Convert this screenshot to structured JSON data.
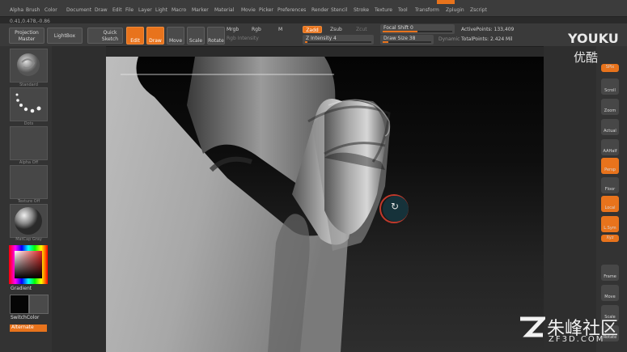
{
  "menu": [
    "Alpha",
    "Brush",
    "Color",
    "Document",
    "Draw",
    "Edit",
    "File",
    "Layer",
    "Light",
    "Macro",
    "Marker",
    "Material",
    "Movie",
    "Picker",
    "Preferences",
    "Render",
    "Stencil",
    "Stroke",
    "Texture",
    "Tool",
    "Transform",
    "Zplugin",
    "Zscript"
  ],
  "coords": "0.41,0.478,-0.86",
  "shelf": {
    "projection_master": "Projection\nMaster",
    "lightbox": "LightBox",
    "quick_sketch": "Quick\nSketch",
    "edit": "Edit",
    "draw": "Draw",
    "move": "Move",
    "scale": "Scale",
    "rotate": "Rotate",
    "mrgb": "Mrgb",
    "rgb": "Rgb",
    "m": "M",
    "rgb_intensity": "Rgb Intensity",
    "zadd": "Zadd",
    "zsub": "Zsub",
    "zcut": "Zcut",
    "z_intensity": "Z Intensity 4",
    "z_intensity_value": 0.04,
    "focal_shift": "Focal Shift 0",
    "focal_shift_value": 0.5,
    "draw_size": "Draw Size 38",
    "draw_size_value": 0.12,
    "dynamic": "Dynamic",
    "active_points": "ActivePoints: 133,409",
    "total_points": "TotalPoints: 2.424 Mil"
  },
  "left": {
    "brush_caption": "Standard",
    "stroke_caption": "Dots",
    "alpha_caption": "Alpha Off",
    "texture_caption": "Texture Off",
    "material_caption": "MatCap Gray",
    "gradient": "Gradient",
    "switch_color": "SwitchColor",
    "alternate": "Alternate"
  },
  "right": [
    "SPix",
    "Scroll",
    "Zoom",
    "Actual",
    "AAHalf",
    "Persp",
    "Floor",
    "Local",
    "L.Sym",
    "Xyz",
    "Frame",
    "Move",
    "Scale",
    "Rotate"
  ],
  "watermark": {
    "youku": "YOUKU",
    "youku_cn": "优酷",
    "zf_cn": "朱峰社区",
    "zf_url": "ZF3D.COM"
  },
  "colors": {
    "accent": "#e8731c",
    "panel": "#3a3a3a",
    "canvas": "#0a0a0a"
  }
}
